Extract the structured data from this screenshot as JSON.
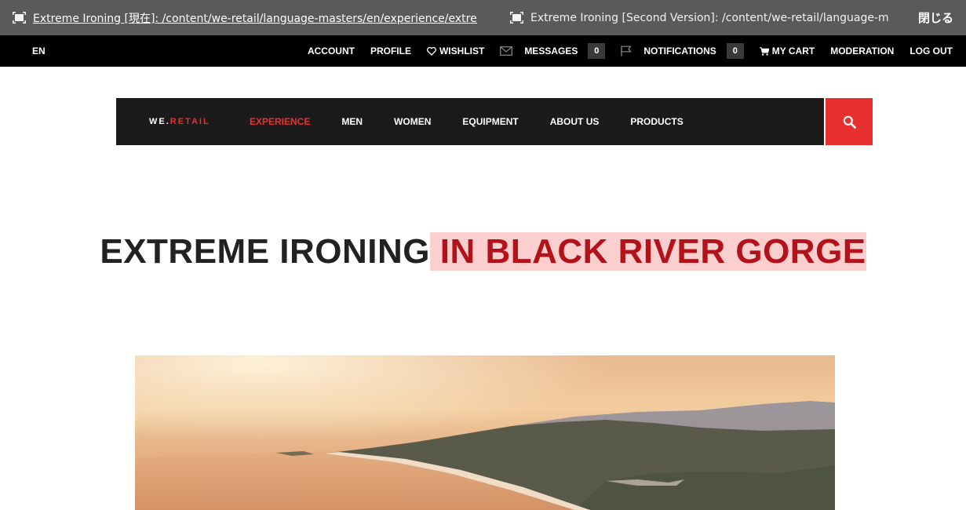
{
  "compare_bar": {
    "current_version": "Extreme Ironing [現在]: /content/we-retail/language-masters/en/experience/extreme-iro",
    "second_version": "Extreme Ironing [Second Version]: /content/we-retail/language-masters/",
    "close_label": "閉じる"
  },
  "account_bar": {
    "language": "EN",
    "account": "ACCOUNT",
    "profile": "PROFILE",
    "wishlist": "WISHLIST",
    "messages": "MESSAGES",
    "messages_count": "0",
    "notifications": "NOTIFICATIONS",
    "notifications_count": "0",
    "cart": "MY CART",
    "moderation": "MODERATION",
    "logout": "LOG OUT"
  },
  "main_nav": {
    "logo_prefix": "WE.",
    "logo_accent": "RETAIL",
    "items": [
      "EXPERIENCE",
      "MEN",
      "WOMEN",
      "EQUIPMENT",
      "ABOUT US",
      "PRODUCTS"
    ],
    "active_item": "EXPERIENCE"
  },
  "page": {
    "title_plain": "EXTREME IRONING",
    "title_changed": " IN BLACK RIVER GORGE"
  },
  "colors": {
    "accent": "#e8312f",
    "diff_highlight": "#fccfcf",
    "diff_text": "#b3121a"
  },
  "icons": [
    "compare-icon",
    "heart-icon",
    "envelope-icon",
    "flag-icon",
    "cart-icon",
    "search-icon"
  ]
}
